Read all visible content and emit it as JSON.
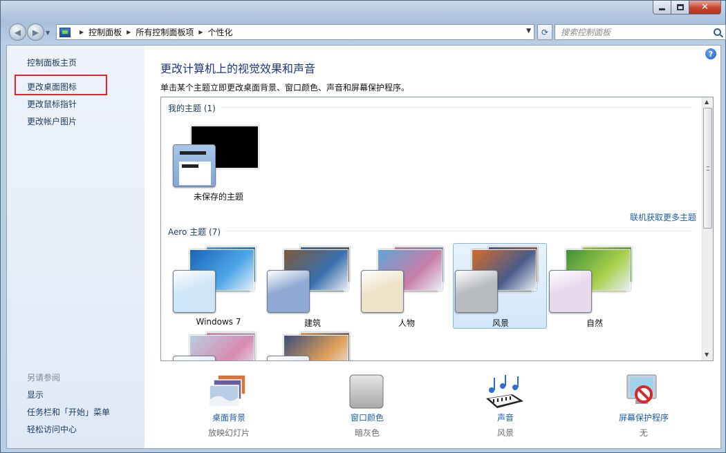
{
  "window": {
    "caption": {
      "min": "minimize",
      "max": "maximize",
      "close": "✕"
    }
  },
  "address_bar": {
    "crumbs": [
      "控制面板",
      "所有控制面板项",
      "个性化"
    ]
  },
  "search": {
    "placeholder": "搜索控制面板"
  },
  "left_pane": {
    "links": [
      {
        "label": "控制面板主页"
      },
      {
        "label": "更改桌面图标"
      },
      {
        "label": "更改鼠标指针"
      },
      {
        "label": "更改帐户图片"
      }
    ],
    "see_also": {
      "heading": "另请参阅",
      "links": [
        {
          "label": "显示"
        },
        {
          "label": "任务栏和「开始」菜单"
        },
        {
          "label": "轻松访问中心"
        }
      ]
    }
  },
  "main": {
    "title": "更改计算机上的视觉效果和声音",
    "description": "单击某个主题立即更改桌面背景、窗口颜色、声音和屏幕保护程序。",
    "help": "?",
    "my_themes": {
      "heading": "我的主题 (1)",
      "items": [
        {
          "label": "未保存的主题"
        }
      ],
      "get_more": "联机获取更多主题"
    },
    "aero_themes": {
      "heading": "Aero 主题 (7)",
      "items": [
        {
          "label": "Windows 7",
          "selected": false,
          "glass": "#cfe6f7",
          "colors": [
            "#1a63b8",
            "#4da7e8"
          ]
        },
        {
          "label": "建筑",
          "selected": false,
          "glass": "#8fa8d4",
          "colors": [
            "#7c5a3a",
            "#3a6fae"
          ]
        },
        {
          "label": "人物",
          "selected": false,
          "glass": "#ede3c8",
          "colors": [
            "#5fa4d8",
            "#c77ea8"
          ]
        },
        {
          "label": "风景",
          "selected": true,
          "glass": "#b8bbc0",
          "colors": [
            "#d46b28",
            "#4a5d8a"
          ]
        },
        {
          "label": "自然",
          "selected": false,
          "glass": "#e7d8ec",
          "colors": [
            "#3f8f3a",
            "#a8d04a"
          ]
        },
        {
          "label": "",
          "selected": false,
          "glass": "#d9e6f0",
          "colors": [
            "#b8cfe0",
            "#d88ab0"
          ]
        },
        {
          "label": "",
          "selected": false,
          "glass": "#dfe4ea",
          "colors": [
            "#3a4e7a",
            "#e0a05a"
          ]
        }
      ]
    },
    "settings": [
      {
        "label": "桌面背景",
        "value": "放映幻灯片",
        "icon": "desktop-background-icon"
      },
      {
        "label": "窗口颜色",
        "value": "暗灰色",
        "icon": "window-color-icon"
      },
      {
        "label": "声音",
        "value": "风景",
        "icon": "sounds-icon"
      },
      {
        "label": "屏幕保护程序",
        "value": "无",
        "icon": "screen-saver-icon"
      }
    ]
  }
}
